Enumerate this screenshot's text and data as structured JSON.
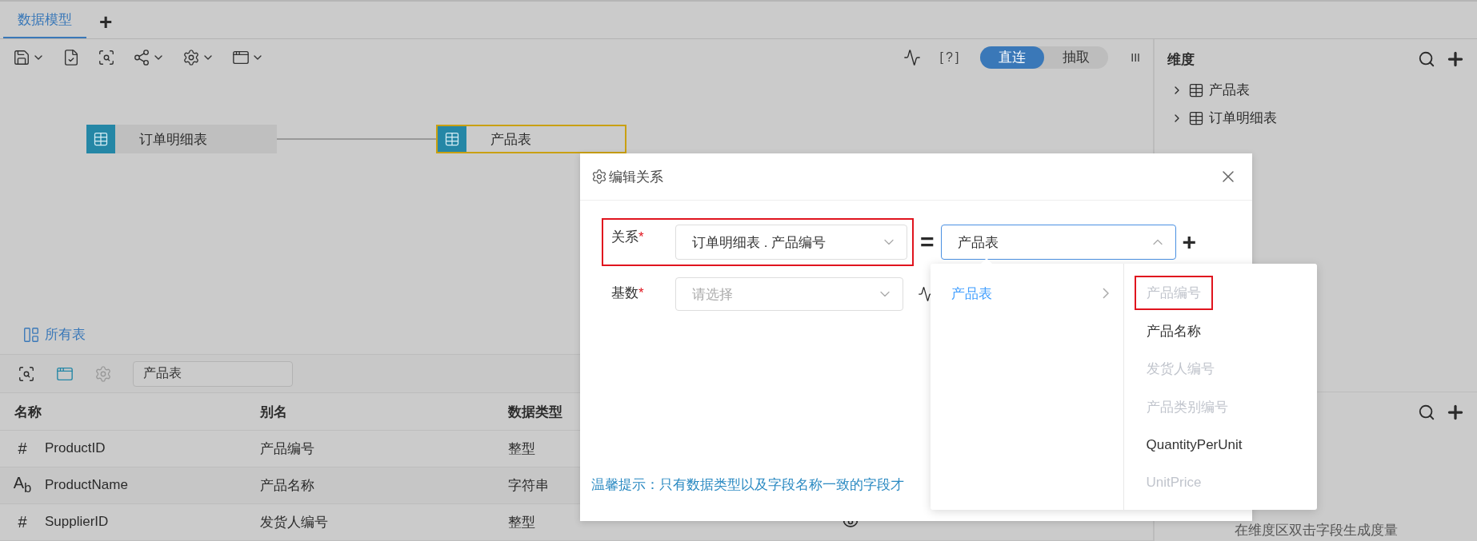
{
  "tabs": [
    {
      "label": "数据模型",
      "selected": true
    }
  ],
  "add_tab": "+",
  "toolbar": {
    "help": "[?]",
    "mode_toggle": [
      {
        "label": "直连",
        "selected": true
      },
      {
        "label": "抽取",
        "selected": false
      }
    ],
    "columns_glyph": "III"
  },
  "canvas": {
    "nodes": [
      {
        "name": "订单明细表",
        "selected": false
      },
      {
        "name": "产品表",
        "selected": true
      }
    ]
  },
  "all_tables": "所有表",
  "table_panel": {
    "search_value": "产品表",
    "columns": [
      "名称",
      "别名",
      "数据类型"
    ],
    "rows": [
      {
        "type_glyph": "#",
        "name": "ProductID",
        "alias": "产品编号",
        "data_type": "整型",
        "shaded": false
      },
      {
        "type_glyph": "A$_{b}$",
        "name": "ProductName",
        "alias": "产品名称",
        "data_type": "字符串",
        "shaded": true
      },
      {
        "type_glyph": "#",
        "name": "SupplierID",
        "alias": "发货人编号",
        "data_type": "整型",
        "shaded": false,
        "visible": true
      }
    ]
  },
  "right_panel": {
    "title": "维度",
    "items": [
      {
        "label": "产品表",
        "expanded": false
      },
      {
        "label": "订单明细表",
        "expanded": false
      }
    ],
    "hint": "在维度区双击字段生成度量"
  },
  "dialog": {
    "title": "编辑关系",
    "fields": [
      {
        "label": "关系",
        "required_mark": "*",
        "highlighted": true,
        "value": "订单明细表 . 产品编号"
      },
      {
        "label": "基数",
        "required_mark": "*",
        "highlighted": false,
        "placeholder": "请选择"
      }
    ],
    "equals": "=",
    "target_select": {
      "value": "产品表",
      "open": true
    },
    "add": "+",
    "tip": "温馨提示：只有数据类型以及字段名称一致的字段才"
  },
  "dropdown": {
    "tables": [
      {
        "label": "产品表",
        "selected": true
      }
    ],
    "fields": [
      {
        "label": "产品编号",
        "disabled": true,
        "highlighted": true
      },
      {
        "label": "产品名称",
        "disabled": false,
        "highlighted": false
      },
      {
        "label": "发货人编号",
        "disabled": true,
        "highlighted": false
      },
      {
        "label": "产品类别编号",
        "disabled": true,
        "highlighted": false
      },
      {
        "label": "QuantityPerUnit",
        "disabled": false,
        "highlighted": false
      },
      {
        "label": "UnitPrice",
        "disabled": true,
        "highlighted": false
      }
    ]
  }
}
